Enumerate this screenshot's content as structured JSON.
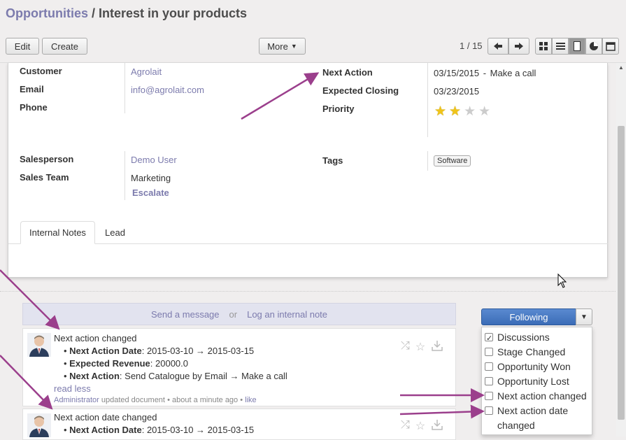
{
  "header": {
    "breadcrumb_parent": "Opportunities",
    "breadcrumb_sep": " / ",
    "breadcrumb_title": "Interest in your products",
    "edit_label": "Edit",
    "create_label": "Create",
    "more_label": "More",
    "pager": "1 / 15"
  },
  "form": {
    "customer_label": "Customer",
    "customer_value": "Agrolait",
    "email_label": "Email",
    "email_value": "info@agrolait.com",
    "phone_label": "Phone",
    "next_action_label": "Next Action",
    "next_action_date": "03/15/2015",
    "next_action_value": "Make a call",
    "expected_closing_label": "Expected Closing",
    "expected_closing_value": "03/23/2015",
    "priority_label": "Priority",
    "priority_stars": 2,
    "priority_max": 4,
    "salesperson_label": "Salesperson",
    "salesperson_value": "Demo User",
    "sales_team_label": "Sales Team",
    "sales_team_value": "Marketing",
    "escalate_label": "Escalate",
    "tags_label": "Tags",
    "tag_value": "Software"
  },
  "tabs": [
    {
      "label": "Internal Notes",
      "active": true
    },
    {
      "label": "Lead",
      "active": false
    }
  ],
  "chatter": {
    "send_message": "Send a message",
    "or": "or",
    "log_note": "Log an internal note",
    "messages": [
      {
        "title": "Next action changed",
        "lines": [
          {
            "field": "Next Action Date",
            "text": ": 2015-03-10 → 2015-03-15"
          },
          {
            "field": "Expected Revenue",
            "text": ": 20000.0"
          },
          {
            "field": "Next Action",
            "text": ": Send Catalogue by Email → Make a call"
          }
        ],
        "read_less": "read less",
        "author": "Administrator",
        "action": "updated document",
        "time": "about a minute ago",
        "like": "like"
      },
      {
        "title": "Next action date changed",
        "lines": [
          {
            "field": "Next Action Date",
            "text": ": 2015-03-10 → 2015-03-15"
          }
        ]
      }
    ]
  },
  "follow": {
    "button_label": "Following",
    "options": [
      {
        "label": "Discussions",
        "checked": true
      },
      {
        "label": "Stage Changed",
        "checked": false
      },
      {
        "label": "Opportunity Won",
        "checked": false
      },
      {
        "label": "Opportunity Lost",
        "checked": false
      },
      {
        "label": "Next action changed",
        "checked": false
      },
      {
        "label": "Next action date changed",
        "checked": false
      }
    ]
  },
  "colors": {
    "accent": "#7c7bad",
    "annotation_arrow": "#9b3f8c",
    "following_button": "#3b6cb7",
    "star_on": "#f0c419",
    "star_off": "#cccccc"
  }
}
